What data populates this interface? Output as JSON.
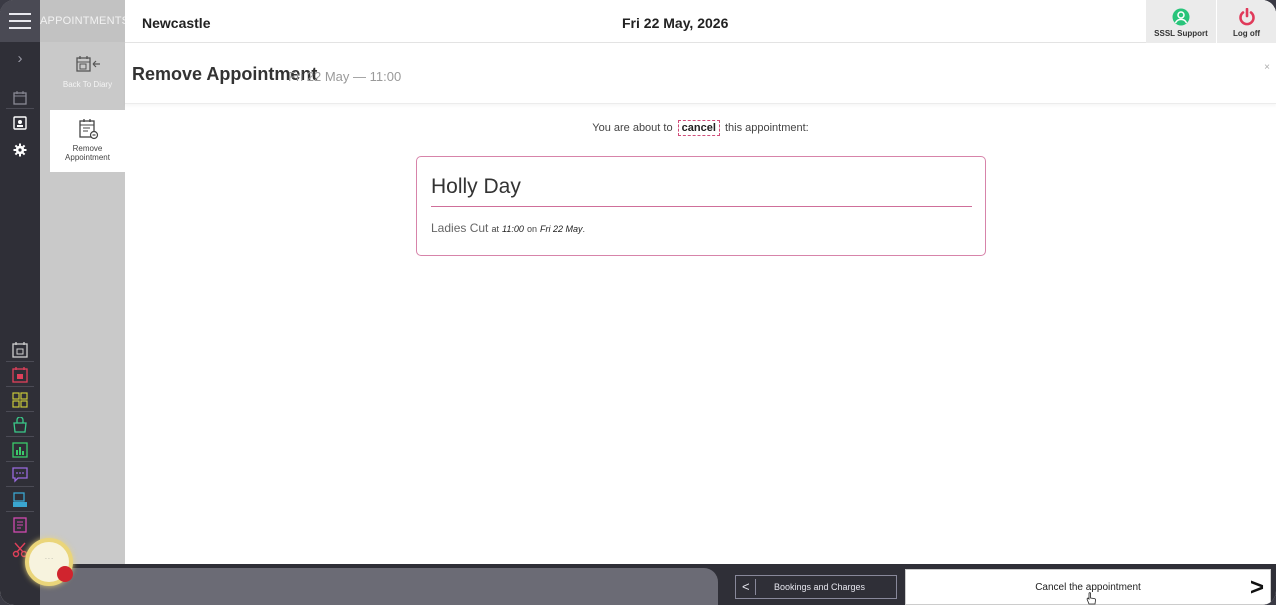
{
  "app": {
    "section_label": "APPOINTMENTS",
    "location": "Newcastle",
    "date": "Fri 22 May, 2026"
  },
  "header": {
    "support_label": "SSSL Support",
    "logoff_label": "Log off",
    "support_color": "#28c47a",
    "logoff_color": "#e03a5a"
  },
  "menu": {
    "back_label": "Back To Diary",
    "active_label": "Remove Appointment"
  },
  "page": {
    "title": "Remove Appointment",
    "subtitle": "Fri 22 May — 11:00",
    "close_label": "×"
  },
  "notice": {
    "before": "You are about to",
    "keyword": "cancel",
    "after": "this appointment:"
  },
  "appointment": {
    "client": "Holly Day",
    "service": "Ladies Cut",
    "at": "at",
    "time": "11:00",
    "on": "on",
    "day": "Fri 22 May",
    "end": ".",
    "accent_color": "#d784aa"
  },
  "footer": {
    "prev_label": "Bookings and Charges",
    "action_label": "Cancel the appointment",
    "prev_arrow": "<",
    "next_arrow": ">"
  },
  "rail_icons": [
    {
      "name": "diary-icon",
      "color": "#9a9aa6"
    },
    {
      "name": "contacts-icon",
      "color": "#ffffff"
    },
    {
      "name": "settings-icon",
      "color": "#ffffff"
    },
    {
      "name": "calendar-icon",
      "color": "#cfcfcf"
    },
    {
      "name": "calendar-red-icon",
      "color": "#e0405a"
    },
    {
      "name": "grid-icon",
      "color": "#c8c83a"
    },
    {
      "name": "basket-icon",
      "color": "#3acb8a"
    },
    {
      "name": "report-icon",
      "color": "#3acb6a"
    },
    {
      "name": "chat-icon",
      "color": "#9a6ae0"
    },
    {
      "name": "till-icon",
      "color": "#3aa6d0"
    },
    {
      "name": "document-icon",
      "color": "#d04ab0"
    },
    {
      "name": "scissors-icon",
      "color": "#e0405a"
    }
  ]
}
